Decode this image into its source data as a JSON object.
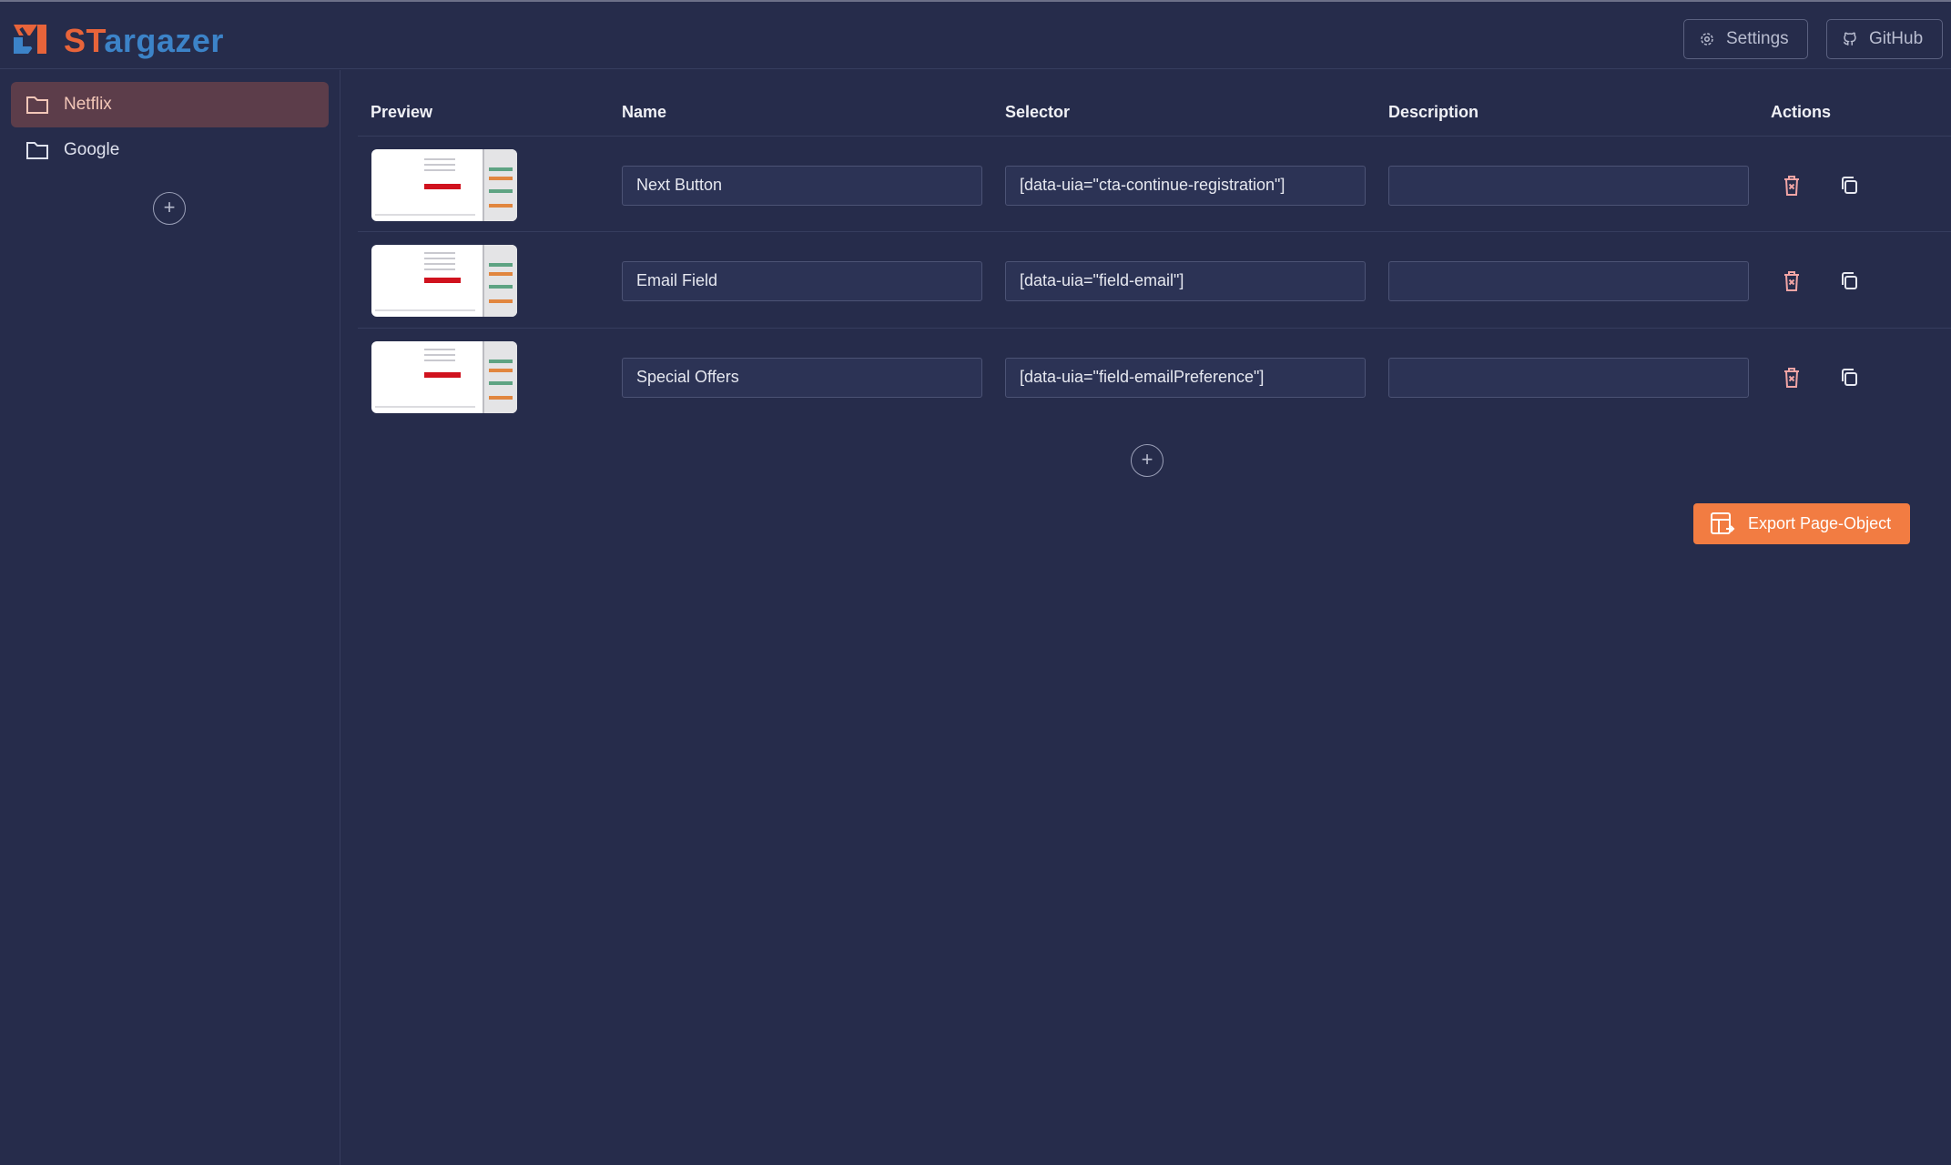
{
  "app": {
    "brand_part1": "ST",
    "brand_part2": "argazer"
  },
  "header": {
    "settings_label": "Settings",
    "github_label": "GitHub"
  },
  "sidebar": {
    "items": [
      {
        "label": "Netflix",
        "active": true
      },
      {
        "label": "Google",
        "active": false
      }
    ]
  },
  "table": {
    "headers": {
      "preview": "Preview",
      "name": "Name",
      "selector": "Selector",
      "description": "Description",
      "actions": "Actions"
    },
    "rows": [
      {
        "name": "Next Button",
        "selector": "[data-uia=\"cta-continue-registration\"]",
        "description": ""
      },
      {
        "name": "Email Field",
        "selector": "[data-uia=\"field-email\"]",
        "description": ""
      },
      {
        "name": "Special Offers",
        "selector": "[data-uia=\"field-emailPreference\"]",
        "description": ""
      }
    ]
  },
  "export_label": "Export Page-Object",
  "colors": {
    "background": "#262c4b",
    "accent": "#f27c42",
    "active_item": "#5c3d4a",
    "brand_orange": "#e8643a",
    "brand_blue": "#3c83c8"
  }
}
